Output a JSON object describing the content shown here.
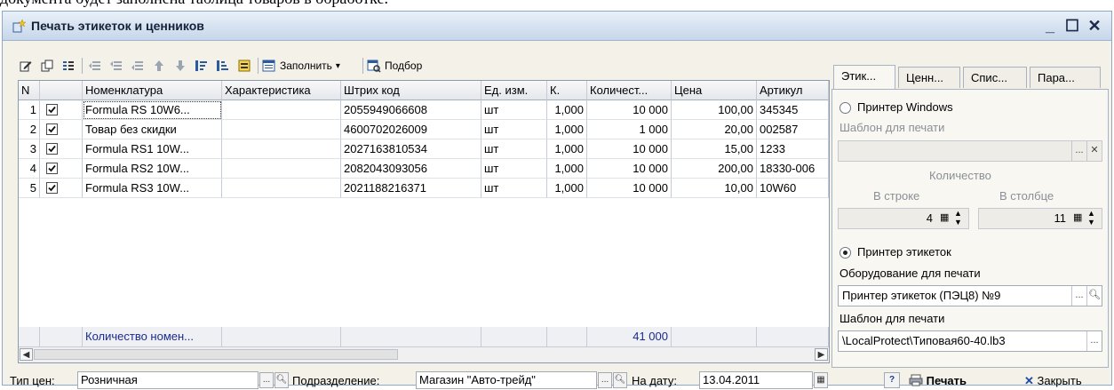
{
  "doc_text": "документа будет заполнена таблица товаров в обработке.",
  "window": {
    "title": "Печать этикеток и ценников",
    "minimize": "_",
    "maximize": "☐",
    "close": "✕"
  },
  "toolbar": {
    "fill_label": "Заполнить",
    "fill_arrow": "▾",
    "select_label": "Подбор"
  },
  "table": {
    "columns": [
      "N",
      "",
      "Номенклатура",
      "Характеристика",
      "Штрих код",
      "Ед. изм.",
      "К.",
      "Количест...",
      "Цена",
      "Артикул"
    ],
    "rows": [
      {
        "n": "1",
        "checked": true,
        "name": "Formula RS 10W6...",
        "char": "",
        "barcode": "2055949066608",
        "unit": "шт",
        "k": "1,000",
        "qty": "10 000",
        "price": "100,00",
        "article": "345345"
      },
      {
        "n": "2",
        "checked": true,
        "name": "Товар без скидки",
        "char": "",
        "barcode": "4600702026009",
        "unit": "шт",
        "k": "1,000",
        "qty": "1 000",
        "price": "20,00",
        "article": "002587"
      },
      {
        "n": "3",
        "checked": true,
        "name": "Formula RS1 10W...",
        "char": "",
        "barcode": "2027163810534",
        "unit": "шт",
        "k": "1,000",
        "qty": "10 000",
        "price": "15,00",
        "article": "1233"
      },
      {
        "n": "4",
        "checked": true,
        "name": "Formula RS2 10W...",
        "char": "",
        "barcode": "2082043093056",
        "unit": "шт",
        "k": "1,000",
        "qty": "10 000",
        "price": "200,00",
        "article": "18330-006"
      },
      {
        "n": "5",
        "checked": true,
        "name": "Formula RS3 10W...",
        "char": "",
        "barcode": "2021188216371",
        "unit": "шт",
        "k": "1,000",
        "qty": "10 000",
        "price": "10,00",
        "article": "10W60"
      }
    ],
    "footer": {
      "name": "Количество номен...",
      "qty": "41 000"
    }
  },
  "panel": {
    "tabs": [
      "Этик...",
      "Ценн...",
      "Спис...",
      "Пара..."
    ],
    "active_tab": 0,
    "radio_windows": "Принтер Windows",
    "template_label_1": "Шаблон для печати",
    "quantity_label": "Количество",
    "in_row_label": "В строке",
    "in_col_label": "В столбце",
    "in_row_value": "4",
    "in_col_value": "11",
    "radio_label_printer": "Принтер этикеток",
    "equipment_label": "Оборудование для печати",
    "equipment_value": "Принтер этикеток (ПЭЦ8) №9",
    "template_label_2": "Шаблон для печати",
    "template_value": "\\LocalProtect\\Типовая60-40.lb3",
    "selected_printer": "Принтер этикеток"
  },
  "bottom": {
    "price_type_label": "Тип цен:",
    "price_type_value": "Розничная",
    "department_label": "Подразделение:",
    "department_value": "Магазин \"Авто-трейд\"",
    "date_label": "На дату:",
    "date_value": "13.04.2011",
    "help_label": "?",
    "print_label": "Печать",
    "close_label": "Закрыть"
  },
  "colors": {
    "title_bg": "#c6d6ea",
    "footer_text": "#1b2a8f",
    "panel_bg": "#f8f7f2",
    "window_bg": "#f4f1e9"
  }
}
